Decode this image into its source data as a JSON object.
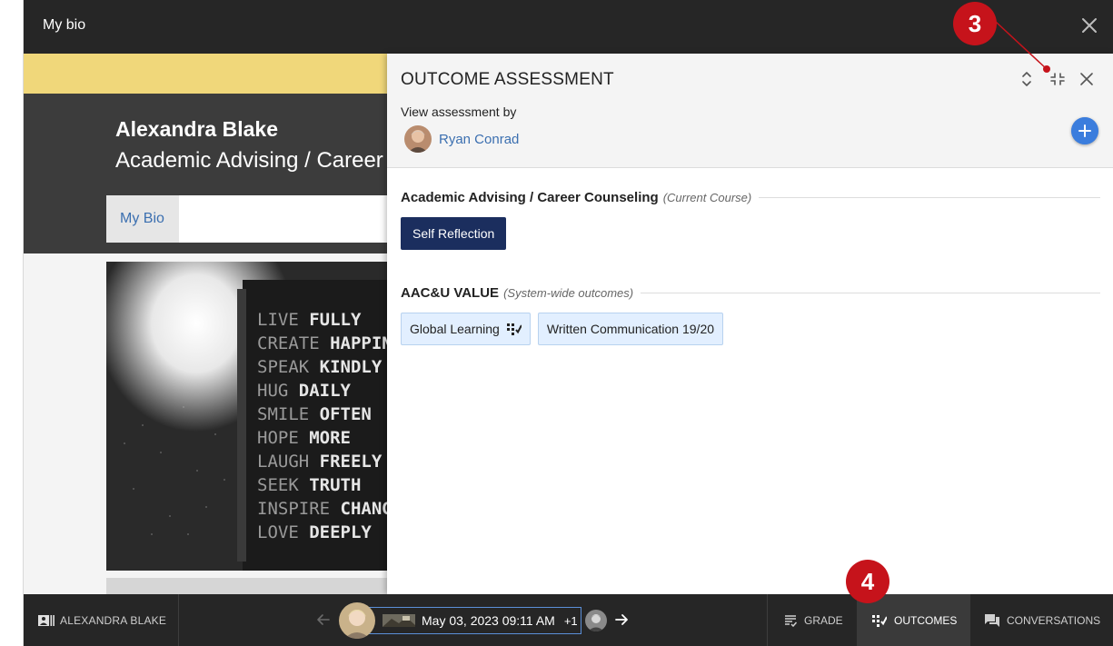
{
  "window": {
    "title": "My bio"
  },
  "bio": {
    "name": "Alexandra Blake",
    "course": "Academic Advising / Career Counseling",
    "tab": "My Bio"
  },
  "panel": {
    "title": "OUTCOME ASSESSMENT",
    "view_label": "View assessment by",
    "assessor_name": "Ryan Conrad",
    "sections": [
      {
        "title": "Academic Advising / Career Counseling",
        "subtitle": "(Current Course)",
        "chips": [
          "Self Reflection"
        ]
      },
      {
        "title": "AAC&U VALUE",
        "subtitle": "(System-wide outcomes)",
        "chips": [
          "Global Learning",
          "Written Communication 19/20"
        ]
      }
    ]
  },
  "bottom_bar": {
    "student_label": "ALEXANDRA BLAKE",
    "submission_date": "May 03, 2023 09:11 AM",
    "extra_count": "+1",
    "tabs": {
      "grade": "GRADE",
      "outcomes": "OUTCOMES",
      "conversations": "CONVERSATIONS"
    },
    "active_tab": "outcomes"
  },
  "callouts": [
    "3",
    "4"
  ],
  "poster_lines": [
    {
      "light": "LIVE",
      "bold": "FULLY"
    },
    {
      "light": "CREATE",
      "bold": "HAPPIN"
    },
    {
      "light": "SPEAK",
      "bold": "KINDLY"
    },
    {
      "light": "HUG",
      "bold": "DAILY"
    },
    {
      "light": "SMILE",
      "bold": "OFTEN"
    },
    {
      "light": "HOPE",
      "bold": "MORE"
    },
    {
      "light": "LAUGH",
      "bold": "FREELY"
    },
    {
      "light": "SEEK",
      "bold": "TRUTH"
    },
    {
      "light": "INSPIRE",
      "bold": "CHANG"
    },
    {
      "light": "LOVE",
      "bold": "DEEPLY"
    }
  ],
  "colors": {
    "accent_blue": "#3b7ddd",
    "chip_dark": "#1b2e5e",
    "chip_light": "#e2efff",
    "callout_red": "#c6131b",
    "bar_dark": "#262626",
    "banner_yellow": "#f0d77a"
  }
}
